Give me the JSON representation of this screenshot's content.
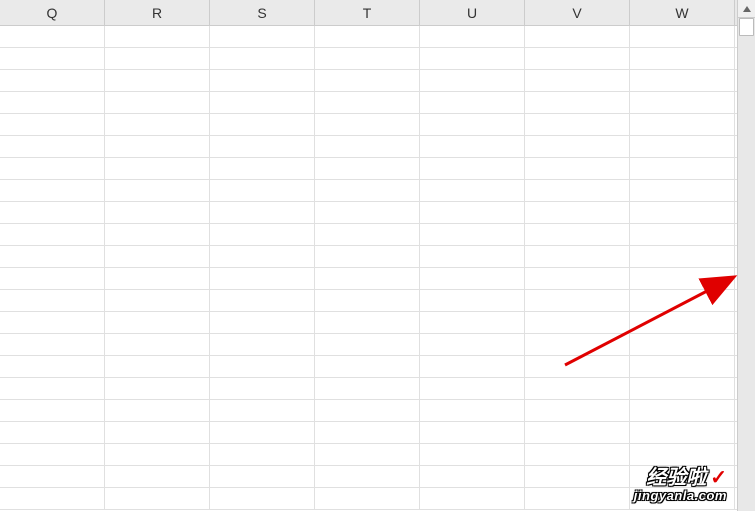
{
  "columns": [
    "Q",
    "R",
    "S",
    "T",
    "U",
    "V",
    "W"
  ],
  "rowCount": 22,
  "watermark": {
    "line1": "经验啦",
    "check": "✓",
    "line2": "jingyanla.com"
  }
}
